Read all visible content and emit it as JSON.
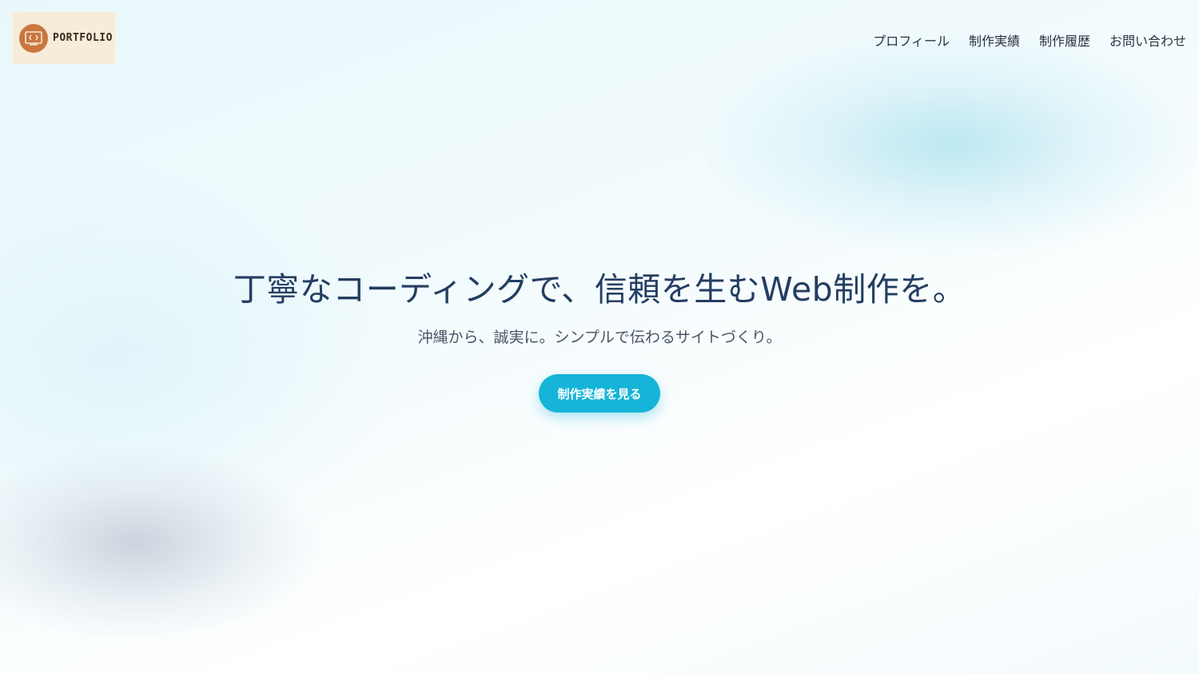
{
  "header": {
    "logo_text": "PORTFOLIO",
    "logo_icon": "code-brackets-icon",
    "nav": [
      {
        "label": "プロフィール"
      },
      {
        "label": "制作実績"
      },
      {
        "label": "制作履歴"
      },
      {
        "label": "お問い合わせ"
      }
    ]
  },
  "hero": {
    "title": "丁寧なコーディングで、信頼を生むWeb制作を。",
    "subtitle": "沖縄から、誠実に。シンプルで伝わるサイトづくり。",
    "cta_label": "制作実績を見る"
  },
  "colors": {
    "accent": "#16b4d8",
    "heading": "#243e62",
    "logo_bg": "#f7ecd9",
    "logo_badge": "#c9773f"
  }
}
